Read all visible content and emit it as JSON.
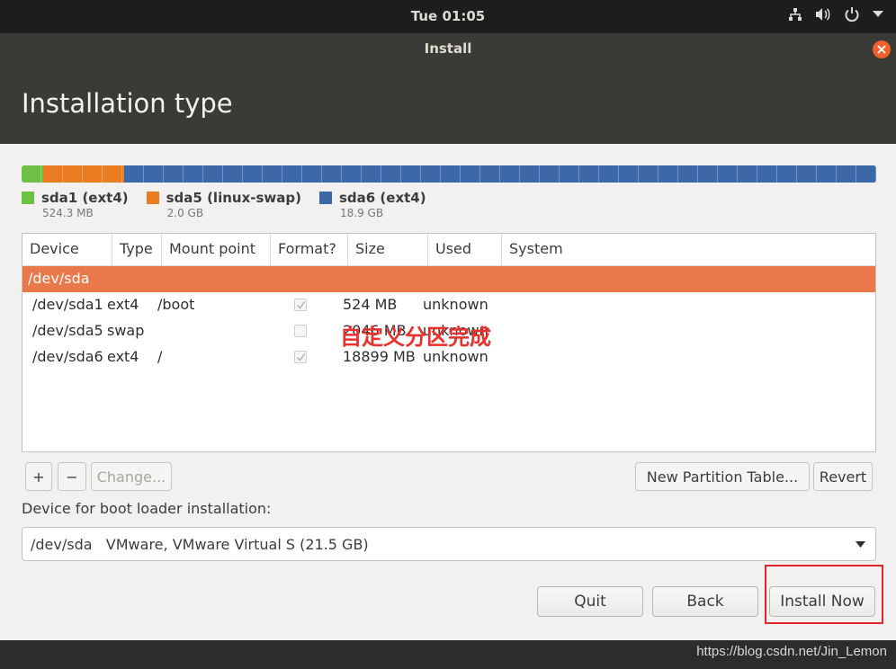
{
  "top_panel": {
    "clock": "Tue 01:05",
    "icons": [
      "network-icon",
      "volume-icon",
      "power-icon",
      "menu-arrow-icon"
    ]
  },
  "window": {
    "title": "Install"
  },
  "page": {
    "title": "Installation type"
  },
  "partitions": {
    "legend": [
      {
        "name": "sda1 (ext4)",
        "size": "524.3 MB",
        "color": "#6dbf45"
      },
      {
        "name": "sda5 (linux-swap)",
        "size": "2.0 GB",
        "color": "#ea7c22"
      },
      {
        "name": "sda6 (ext4)",
        "size": "18.9 GB",
        "color": "#3c68a8"
      }
    ],
    "bar_fractions": [
      0.025,
      0.095,
      0.88
    ]
  },
  "table": {
    "headers": [
      "Device",
      "Type",
      "Mount point",
      "Format?",
      "Size",
      "Used",
      "System"
    ],
    "disk_row": "/dev/sda",
    "rows": [
      {
        "device": "/dev/sda1",
        "type": "ext4",
        "mount": "/boot",
        "format": true,
        "size": "524 MB",
        "used": "unknown",
        "system": ""
      },
      {
        "device": "/dev/sda5",
        "type": "swap",
        "mount": "",
        "format": false,
        "size": "2046 MB",
        "used": "unknown",
        "system": ""
      },
      {
        "device": "/dev/sda6",
        "type": "ext4",
        "mount": "/",
        "format": true,
        "size": "18899 MB",
        "used": "unknown",
        "system": ""
      }
    ]
  },
  "annotation": "自定义分区完成",
  "toolbar": {
    "add": "+",
    "remove": "−",
    "change": "Change...",
    "new_table": "New Partition Table...",
    "revert": "Revert"
  },
  "bootloader": {
    "label": "Device for boot loader installation:",
    "selected": "/dev/sda   VMware, VMware Virtual S (21.5 GB)"
  },
  "actions": {
    "quit": "Quit",
    "back": "Back",
    "install": "Install Now"
  },
  "watermark": "https://blog.csdn.net/Jin_Lemon",
  "colors": {
    "accent": "#e9784a",
    "highlight": "#e0242a",
    "close": "#f0612e"
  }
}
